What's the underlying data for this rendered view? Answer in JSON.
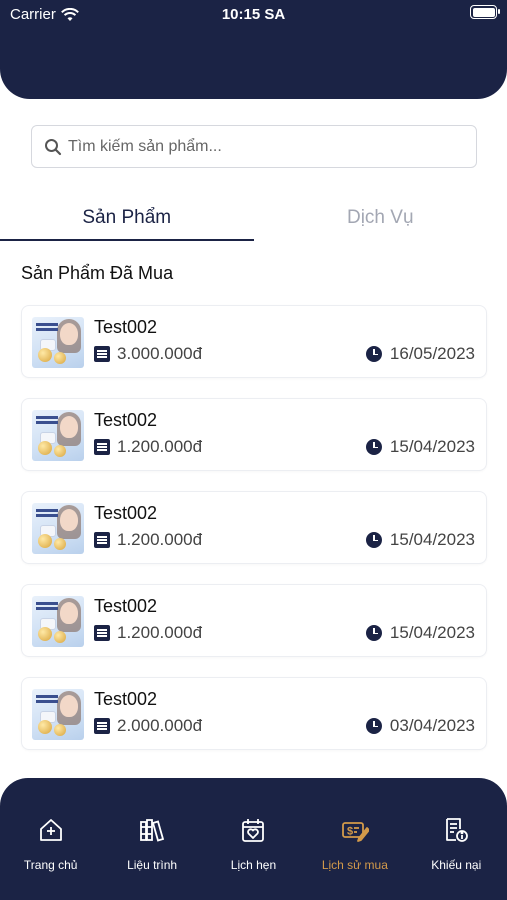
{
  "status_bar": {
    "carrier": "Carrier",
    "time": "10:15 SA"
  },
  "search": {
    "placeholder": "Tìm kiếm sản phẩm..."
  },
  "tabs": [
    {
      "label": "Sản Phẩm",
      "active": true
    },
    {
      "label": "Dịch Vụ",
      "active": false
    }
  ],
  "section_title": "Sản Phẩm Đã Mua",
  "purchases": [
    {
      "name": "Test002",
      "price": "3.000.000đ",
      "date": "16/05/2023"
    },
    {
      "name": "Test002",
      "price": "1.200.000đ",
      "date": "15/04/2023"
    },
    {
      "name": "Test002",
      "price": "1.200.000đ",
      "date": "15/04/2023"
    },
    {
      "name": "Test002",
      "price": "1.200.000đ",
      "date": "15/04/2023"
    },
    {
      "name": "Test002",
      "price": "2.000.000đ",
      "date": "03/04/2023"
    }
  ],
  "bottom_nav": [
    {
      "label": "Trang chủ",
      "icon": "home-plus-icon",
      "active": false
    },
    {
      "label": "Liệu trình",
      "icon": "treatment-books-icon",
      "active": false
    },
    {
      "label": "Lịch hẹn",
      "icon": "calendar-heart-icon",
      "active": false
    },
    {
      "label": "Lịch sử mua",
      "icon": "purchase-history-icon",
      "active": true
    },
    {
      "label": "Khiếu nại",
      "icon": "complaint-doc-icon",
      "active": false
    }
  ],
  "colors": {
    "navy": "#1b2345",
    "active_accent": "#d39a4a",
    "tab_inactive": "#a3a7b3"
  }
}
